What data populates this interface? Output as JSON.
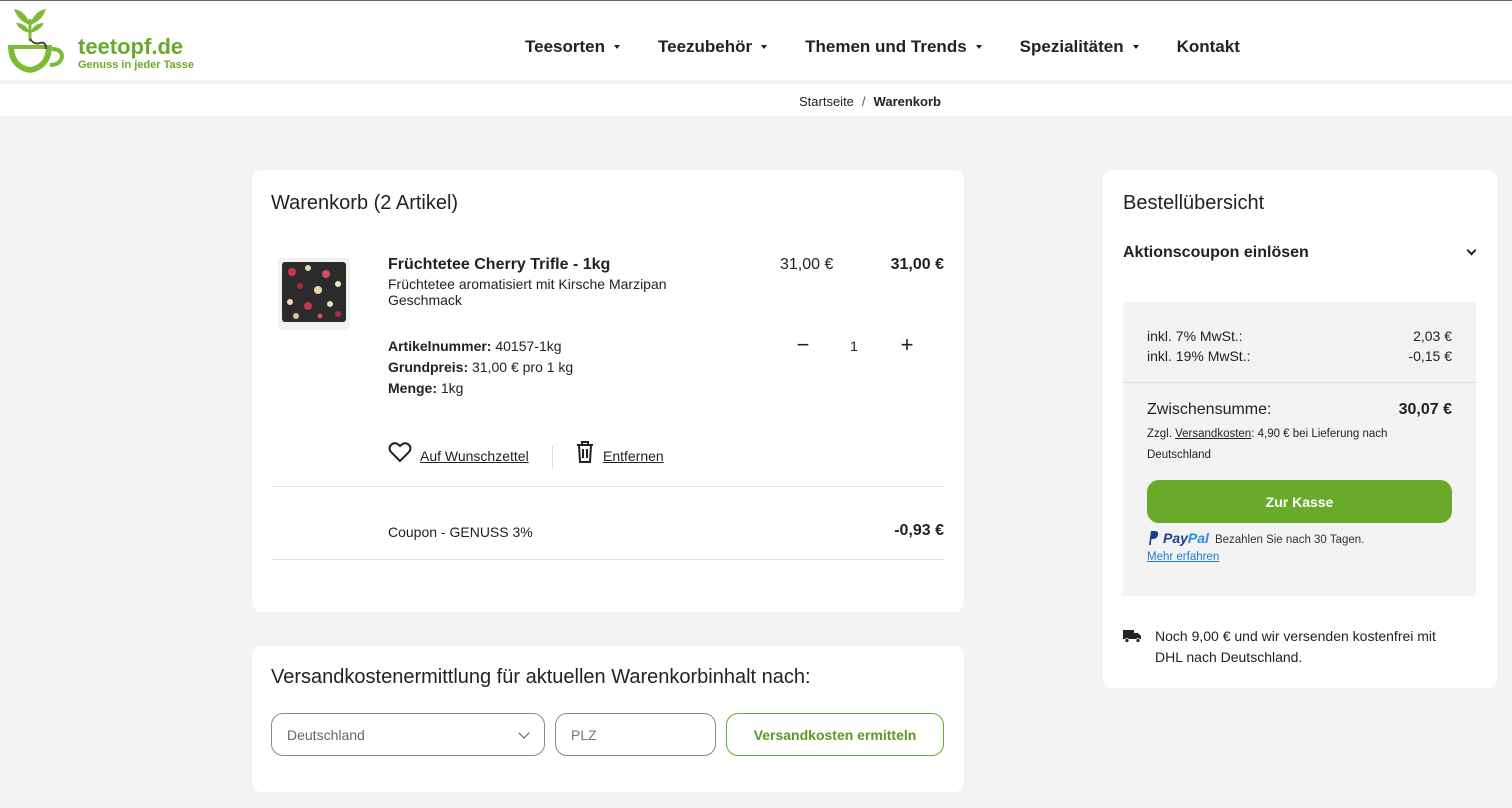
{
  "header": {
    "logo_name": "teetopf.de",
    "logo_tagline": "Genuss in jeder Tasse",
    "nav": [
      {
        "label": "Teesorten",
        "dropdown": true
      },
      {
        "label": "Teezubehör",
        "dropdown": true
      },
      {
        "label": "Themen und Trends",
        "dropdown": true
      },
      {
        "label": "Spezialitäten",
        "dropdown": true
      },
      {
        "label": "Kontakt",
        "dropdown": false
      }
    ]
  },
  "breadcrumb": {
    "home": "Startseite",
    "separator": "/",
    "current": "Warenkorb"
  },
  "cart": {
    "title": "Warenkorb (2 Artikel)",
    "item": {
      "name": "Früchtetee Cherry Trifle - 1kg",
      "description": "Früchtetee aromatisiert mit Kirsche Marzipan Geschmack",
      "unit_price": "31,00 €",
      "total_price": "31,00 €",
      "article_label": "Artikelnummer:",
      "article_value": "40157-1kg",
      "base_price_label": "Grundpreis:",
      "base_price_value": "31,00 € pro 1 kg",
      "amount_label": "Menge:",
      "amount_value": "1kg",
      "quantity": "1",
      "quantity_minus": "−",
      "quantity_plus": "+",
      "wishlist_label": "Auf Wunschzettel",
      "remove_label": "Entfernen"
    },
    "coupon": {
      "label": "Coupon - GENUSS 3%",
      "value": "-0,93 €"
    }
  },
  "shipping_calc": {
    "title": "Versandkostenermittlung für aktuellen Warenkorbinhalt nach:",
    "country_selected": "Deutschland",
    "plz_placeholder": "PLZ",
    "button_label": "Versandkosten ermitteln"
  },
  "summary": {
    "title": "Bestellübersicht",
    "coupon_toggle": "Aktionscoupon einlösen",
    "vat7_label": "inkl. 7% MwSt.:",
    "vat7_value": "2,03 €",
    "vat19_label": "inkl. 19% MwSt.:",
    "vat19_value": "-0,15 €",
    "subtotal_label": "Zwischensumme:",
    "subtotal_value": "30,07 €",
    "shipping_prefix": "Zzgl.",
    "shipping_link": "Versandkosten",
    "shipping_suffix": ": 4,90 € bei Lieferung nach Deutschland",
    "checkout_label": "Zur Kasse",
    "paypal_logo_a": "Pay",
    "paypal_logo_b": "Pal",
    "paypal_text": "Bezahlen Sie nach 30 Tagen.",
    "paypal_more": "Mehr erfahren",
    "free_shipping_text": "Noch 9,00 € und wir versenden kostenfrei mit DHL nach Deutschland."
  },
  "colors": {
    "brand_green": "#6aaa2a",
    "paypal_blue": "#1b3f8c",
    "link_blue": "#1f7bd0"
  }
}
